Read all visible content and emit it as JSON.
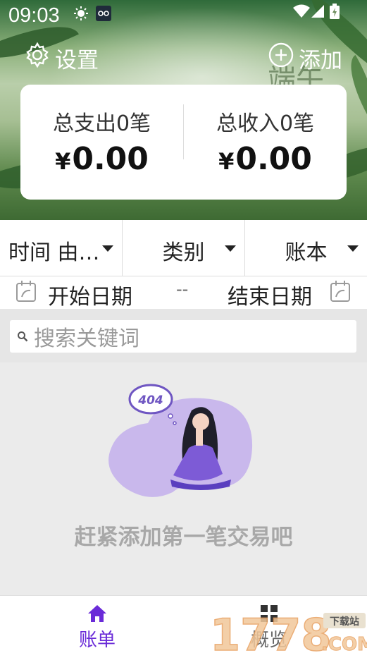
{
  "status_bar": {
    "time": "09:03"
  },
  "header": {
    "settings_label": "设置",
    "add_label": "添加",
    "hero_text": "端午"
  },
  "summary": {
    "expense_label": "总支出0笔",
    "expense_currency": "¥",
    "expense_amount": "0.00",
    "income_label": "总收入0笔",
    "income_currency": "¥",
    "income_amount": "0.00"
  },
  "filters": {
    "time_label": "时间 由…",
    "category_label": "类别",
    "book_label": "账本"
  },
  "date_range": {
    "start_label": "开始日期",
    "separator": "--",
    "end_label": "结束日期"
  },
  "search": {
    "placeholder": "搜索关键词"
  },
  "empty_state": {
    "bubble_text": "404",
    "message": "赶紧添加第一笔交易吧"
  },
  "bottom_nav": {
    "items": [
      {
        "label": "账单",
        "icon": "home-icon",
        "active": true
      },
      {
        "label": "概览",
        "icon": "grid-icon",
        "active": false
      }
    ]
  },
  "watermark": {
    "text": "1778",
    "badge": "下载站",
    "suffix": ".COM"
  },
  "colors": {
    "accent": "#6a2bd8",
    "empty_text": "#a8a8a8",
    "illustration_purple": "#c9b8ec"
  }
}
